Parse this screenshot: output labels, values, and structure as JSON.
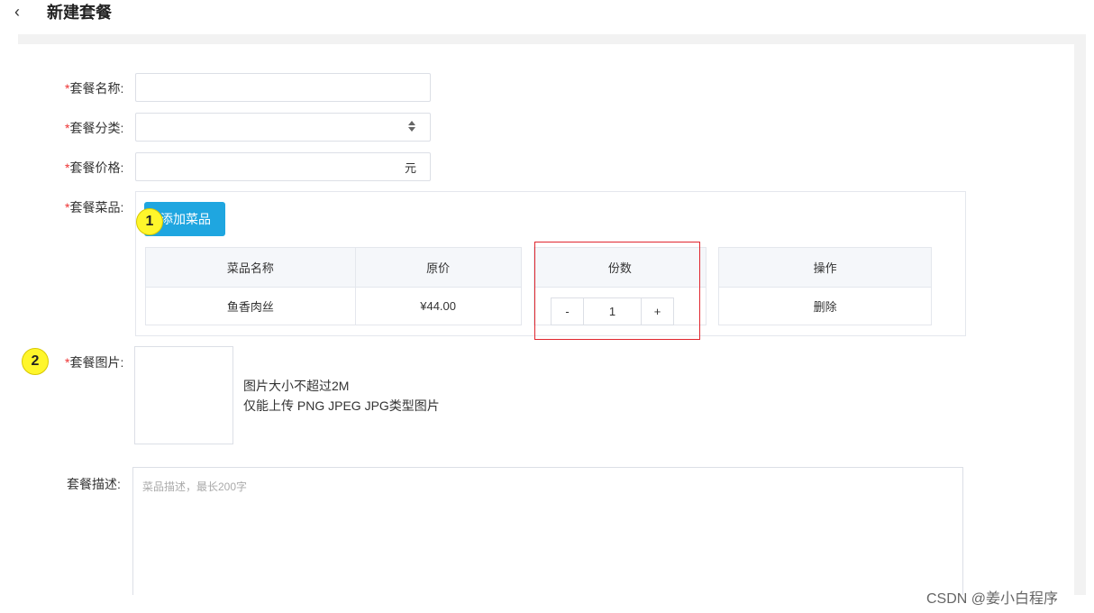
{
  "header": {
    "back_icon": "‹",
    "title": "新建套餐"
  },
  "form": {
    "required_mark": "*",
    "name": {
      "label": "套餐名称:",
      "value": ""
    },
    "category": {
      "label": "套餐分类:",
      "value": ""
    },
    "price": {
      "label": "套餐价格:",
      "value": "",
      "suffix": "元"
    },
    "dishes": {
      "label": "套餐菜品:",
      "add_button": "添加菜品",
      "columns": [
        "菜品名称",
        "原价",
        "份数",
        "操作"
      ],
      "rows": [
        {
          "name": "鱼香肉丝",
          "price": "¥44.00",
          "quantity": "1",
          "action": "删除"
        }
      ],
      "stepper_minus": "-",
      "stepper_plus": "+"
    },
    "image": {
      "label": "套餐图片:",
      "tip_line1": "图片大小不超过2M",
      "tip_line2": "仅能上传 PNG JPEG JPG类型图片"
    },
    "description": {
      "label": "套餐描述:",
      "placeholder": "菜品描述，最长200字"
    }
  },
  "annotations": {
    "marker1": "1",
    "marker2": "2",
    "highlight_color": "#e0262e",
    "marker_color": "#fff62b"
  },
  "watermark": "CSDN @姜小白程序",
  "colors": {
    "primary_button": "#1fa6e0",
    "required": "#e33"
  }
}
